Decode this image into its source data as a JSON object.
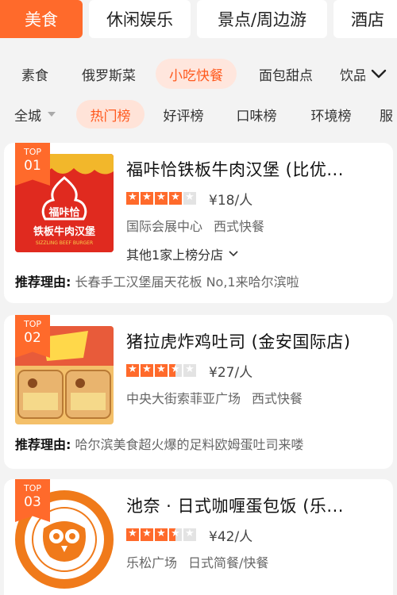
{
  "categories": [
    {
      "label": "美食",
      "active": true
    },
    {
      "label": "休闲娱乐",
      "active": false
    },
    {
      "label": "景点/周边游",
      "active": false
    },
    {
      "label": "酒店",
      "active": false
    }
  ],
  "subcategories": [
    {
      "label": "素食"
    },
    {
      "label": "俄罗斯菜"
    },
    {
      "label": "小吃快餐",
      "active": true
    },
    {
      "label": "面包甜点"
    },
    {
      "label": "饮品"
    }
  ],
  "filters": {
    "area": "全城",
    "rank_tabs": [
      {
        "label": "热门榜",
        "active": true
      },
      {
        "label": "好评榜"
      },
      {
        "label": "口味榜"
      },
      {
        "label": "环境榜"
      },
      {
        "label": "服"
      }
    ]
  },
  "colors": {
    "accent": "#ff6a2b",
    "accent_light": "#ffe3d8"
  },
  "shops": [
    {
      "rank_top": "TOP",
      "rank_no": "01",
      "name": "福咔恰铁板牛肉汉堡 (比优...",
      "rating": 4,
      "price": "¥18/人",
      "tags": [
        "国际会展中心",
        "西式快餐"
      ],
      "branches": "其他1家上榜分店",
      "reason_label": "推荐理由:",
      "reason": "长春手工汉堡届天花板 No,1来哈尔滨啦",
      "logo_brand": "福咔恰",
      "logo_title": "铁板牛肉汉堡",
      "logo_sub": "SIZZLING BEEF BURGER"
    },
    {
      "rank_top": "TOP",
      "rank_no": "02",
      "name": "猪拉虎炸鸡吐司 (金安国际店)",
      "rating": 3.5,
      "price": "¥27/人",
      "tags": [
        "中央大街索菲亚广场",
        "西式快餐"
      ],
      "reason_label": "推荐理由:",
      "reason": "哈尔滨美食超火爆的足料欧姆蛋吐司来喽"
    },
    {
      "rank_top": "TOP",
      "rank_no": "03",
      "name": "池奈 · 日式咖喱蛋包饭 (乐...",
      "rating": 3.5,
      "price": "¥42/人",
      "tags": [
        "乐松广场",
        "日式简餐/快餐"
      ]
    }
  ]
}
